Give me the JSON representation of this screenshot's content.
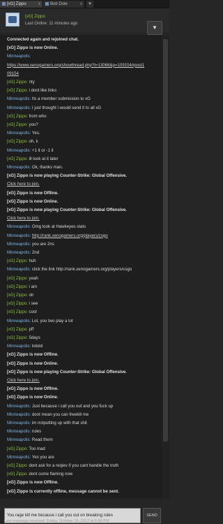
{
  "tabs": [
    {
      "label": "[xG] Zippo",
      "close": "x"
    },
    {
      "label": "Bob Dole",
      "close": "x"
    }
  ],
  "tab_dropdown": "▼",
  "header": {
    "name": "[xG] Zippo",
    "status": "Last Online: 11 minutes ago",
    "menu_icon": "▼"
  },
  "messages": [
    {
      "type": "sys",
      "text": "Connected again and rejoined chat."
    },
    {
      "type": "sys",
      "text": "[xG] Zippo is now Online."
    },
    {
      "type": "u1",
      "user": "Minneapolis:",
      "text": ""
    },
    {
      "type": "link",
      "text": "https://www.xenogamers.org/showthread.php?t=13066&p=109154#post1"
    },
    {
      "type": "link",
      "text": "09154"
    },
    {
      "type": "u2",
      "user": "[xG] Zippo:",
      "text": "nty"
    },
    {
      "type": "u2",
      "user": "[xG] Zippo:",
      "text": "i dont like links"
    },
    {
      "type": "u1",
      "user": "Minneapolis:",
      "text": "Its a member submission to xG"
    },
    {
      "type": "u1",
      "user": "Minneapolis:",
      "text": "I just thought i would send it to all xG"
    },
    {
      "type": "u2",
      "user": "[xG] Zippo:",
      "text": "from who"
    },
    {
      "type": "u2",
      "user": "[xG] Zippo:",
      "text": "you?"
    },
    {
      "type": "u1",
      "user": "Minneapolis:",
      "text": "Yes."
    },
    {
      "type": "u2",
      "user": "[xG] Zippo:",
      "text": "oh, k"
    },
    {
      "type": "u1",
      "user": "Minneapolis:",
      "text": "+1 it or -1 it"
    },
    {
      "type": "u2",
      "user": "[xG] Zippo:",
      "text": "ill look at it later"
    },
    {
      "type": "u1",
      "user": "Minneapolis:",
      "text": "Ok, thanks man."
    },
    {
      "type": "sys",
      "text": "[xG] Zippo is now playing Counter-Strike: Global Offensive."
    },
    {
      "type": "link",
      "text": "Click here to join."
    },
    {
      "type": "sys",
      "text": "[xG] Zippo is now Offline."
    },
    {
      "type": "sys",
      "text": "[xG] Zippo is now Online."
    },
    {
      "type": "sys",
      "text": "[xG] Zippo is now playing Counter-Strike: Global Offensive."
    },
    {
      "type": "link",
      "text": "Click here to join."
    },
    {
      "type": "u1",
      "user": "Minneapolis:",
      "text": "Omg look at Hawkeyes stats"
    },
    {
      "type": "u1",
      "user": "Minneapolis:",
      "text": "http://rank.xenogamers.org/players/csgo",
      "link": true
    },
    {
      "type": "u1",
      "user": "Minneapolis:",
      "text": "you are 2ns"
    },
    {
      "type": "u1",
      "user": "Minneapolis:",
      "text": "2nd"
    },
    {
      "type": "u2",
      "user": "[xG] Zippo:",
      "text": "huh"
    },
    {
      "type": "u1",
      "user": "Minneapolis:",
      "text": "click the link http://rank.xenogamers.org/players/csgo"
    },
    {
      "type": "u2",
      "user": "[xG] Zippo:",
      "text": "yeah"
    },
    {
      "type": "u2",
      "user": "[xG] Zippo:",
      "text": "i am"
    },
    {
      "type": "u2",
      "user": "[xG] Zippo:",
      "text": "oh"
    },
    {
      "type": "u2",
      "user": "[xG] Zippo:",
      "text": "i see"
    },
    {
      "type": "u2",
      "user": "[xG] Zippo:",
      "text": "cool"
    },
    {
      "type": "u1",
      "user": "Minneapolis:",
      "text": "Lol, you two play a lot"
    },
    {
      "type": "u2",
      "user": "[xG] Zippo:",
      "text": "pff"
    },
    {
      "type": "u2",
      "user": "[xG] Zippo:",
      "text": "5days"
    },
    {
      "type": "u1",
      "user": "Minneapolis:",
      "text": "lololol"
    },
    {
      "type": "sys",
      "text": "[xG] Zippo is now Offline."
    },
    {
      "type": "sys",
      "text": "[xG] Zippo is now Online."
    },
    {
      "type": "sys",
      "text": "[xG] Zippo is now playing Counter-Strike: Global Offensive."
    },
    {
      "type": "link",
      "text": "Click here to join."
    },
    {
      "type": "sys",
      "text": "[xG] Zippo is now Offline."
    },
    {
      "type": "sys",
      "text": "[xG] Zippo is now Online."
    },
    {
      "type": "u1",
      "user": "Minneapolis:",
      "text": "Just because i call you out and you fuck up"
    },
    {
      "type": "u1",
      "user": "Minneapolis:",
      "text": "dont mean you can freekill me"
    },
    {
      "type": "u1",
      "user": "Minneapolis:",
      "text": "im  notputting up with that shit"
    },
    {
      "type": "u1",
      "user": "Minneapolis:",
      "text": "rules"
    },
    {
      "type": "u1",
      "user": "Minneapolis:",
      "text": "Read them"
    },
    {
      "type": "u2",
      "user": "[xG] Zippo:",
      "text": "Too mad"
    },
    {
      "type": "u1",
      "user": "Minneapolis:",
      "text": "Yes you are"
    },
    {
      "type": "u2",
      "user": "[xG] Zippo:",
      "text": "dont ask for a reqiev if you cant handle the truth"
    },
    {
      "type": "u2",
      "user": "[xG] Zippo:",
      "text": "dont come flaming now"
    },
    {
      "type": "sys",
      "text": "[xG] Zippo is now Offline."
    },
    {
      "type": "sys",
      "text": "[xG] Zippo is currently offline, message cannot be sent."
    }
  ],
  "input": {
    "value": "You rage kill me because i call you out on breaking rules"
  },
  "send_label": "SEND",
  "footer": "Last message received: Friday, October 19, 2012 at 6:46 PM"
}
